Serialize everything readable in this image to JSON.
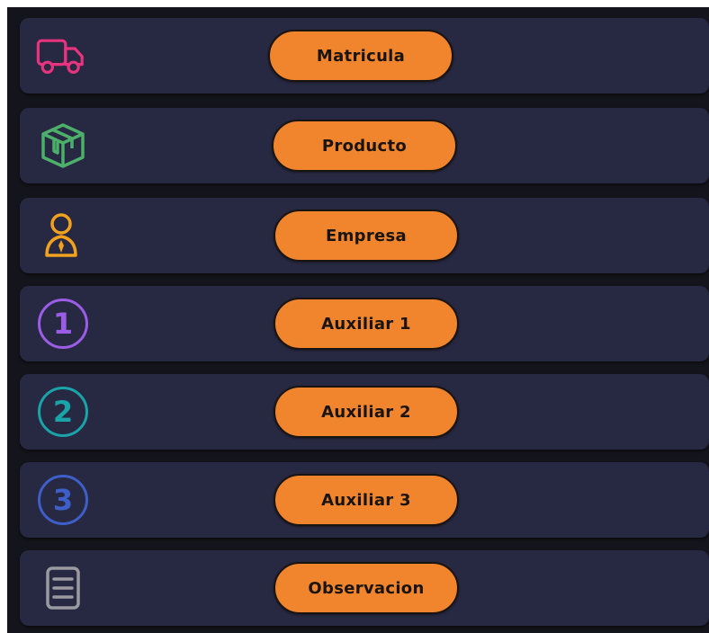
{
  "rows": [
    {
      "label": "Matricula",
      "icon": "truck-icon",
      "color": "#e8347e"
    },
    {
      "label": "Producto",
      "icon": "box-icon",
      "color": "#4caf6a"
    },
    {
      "label": "Empresa",
      "icon": "business-person-icon",
      "color": "#f2a11f"
    },
    {
      "label": "Auxiliar 1",
      "icon": "number-1-circle-icon",
      "icon_text": "1",
      "color": "#9b5de5"
    },
    {
      "label": "Auxiliar 2",
      "icon": "number-2-circle-icon",
      "icon_text": "2",
      "color": "#1aa3a8"
    },
    {
      "label": "Auxiliar 3",
      "icon": "number-3-circle-icon",
      "icon_text": "3",
      "color": "#3f5fc8"
    },
    {
      "label": "Observacion",
      "icon": "document-lines-icon",
      "color": "#9a9aa0"
    }
  ],
  "button_color": "#f0852d"
}
